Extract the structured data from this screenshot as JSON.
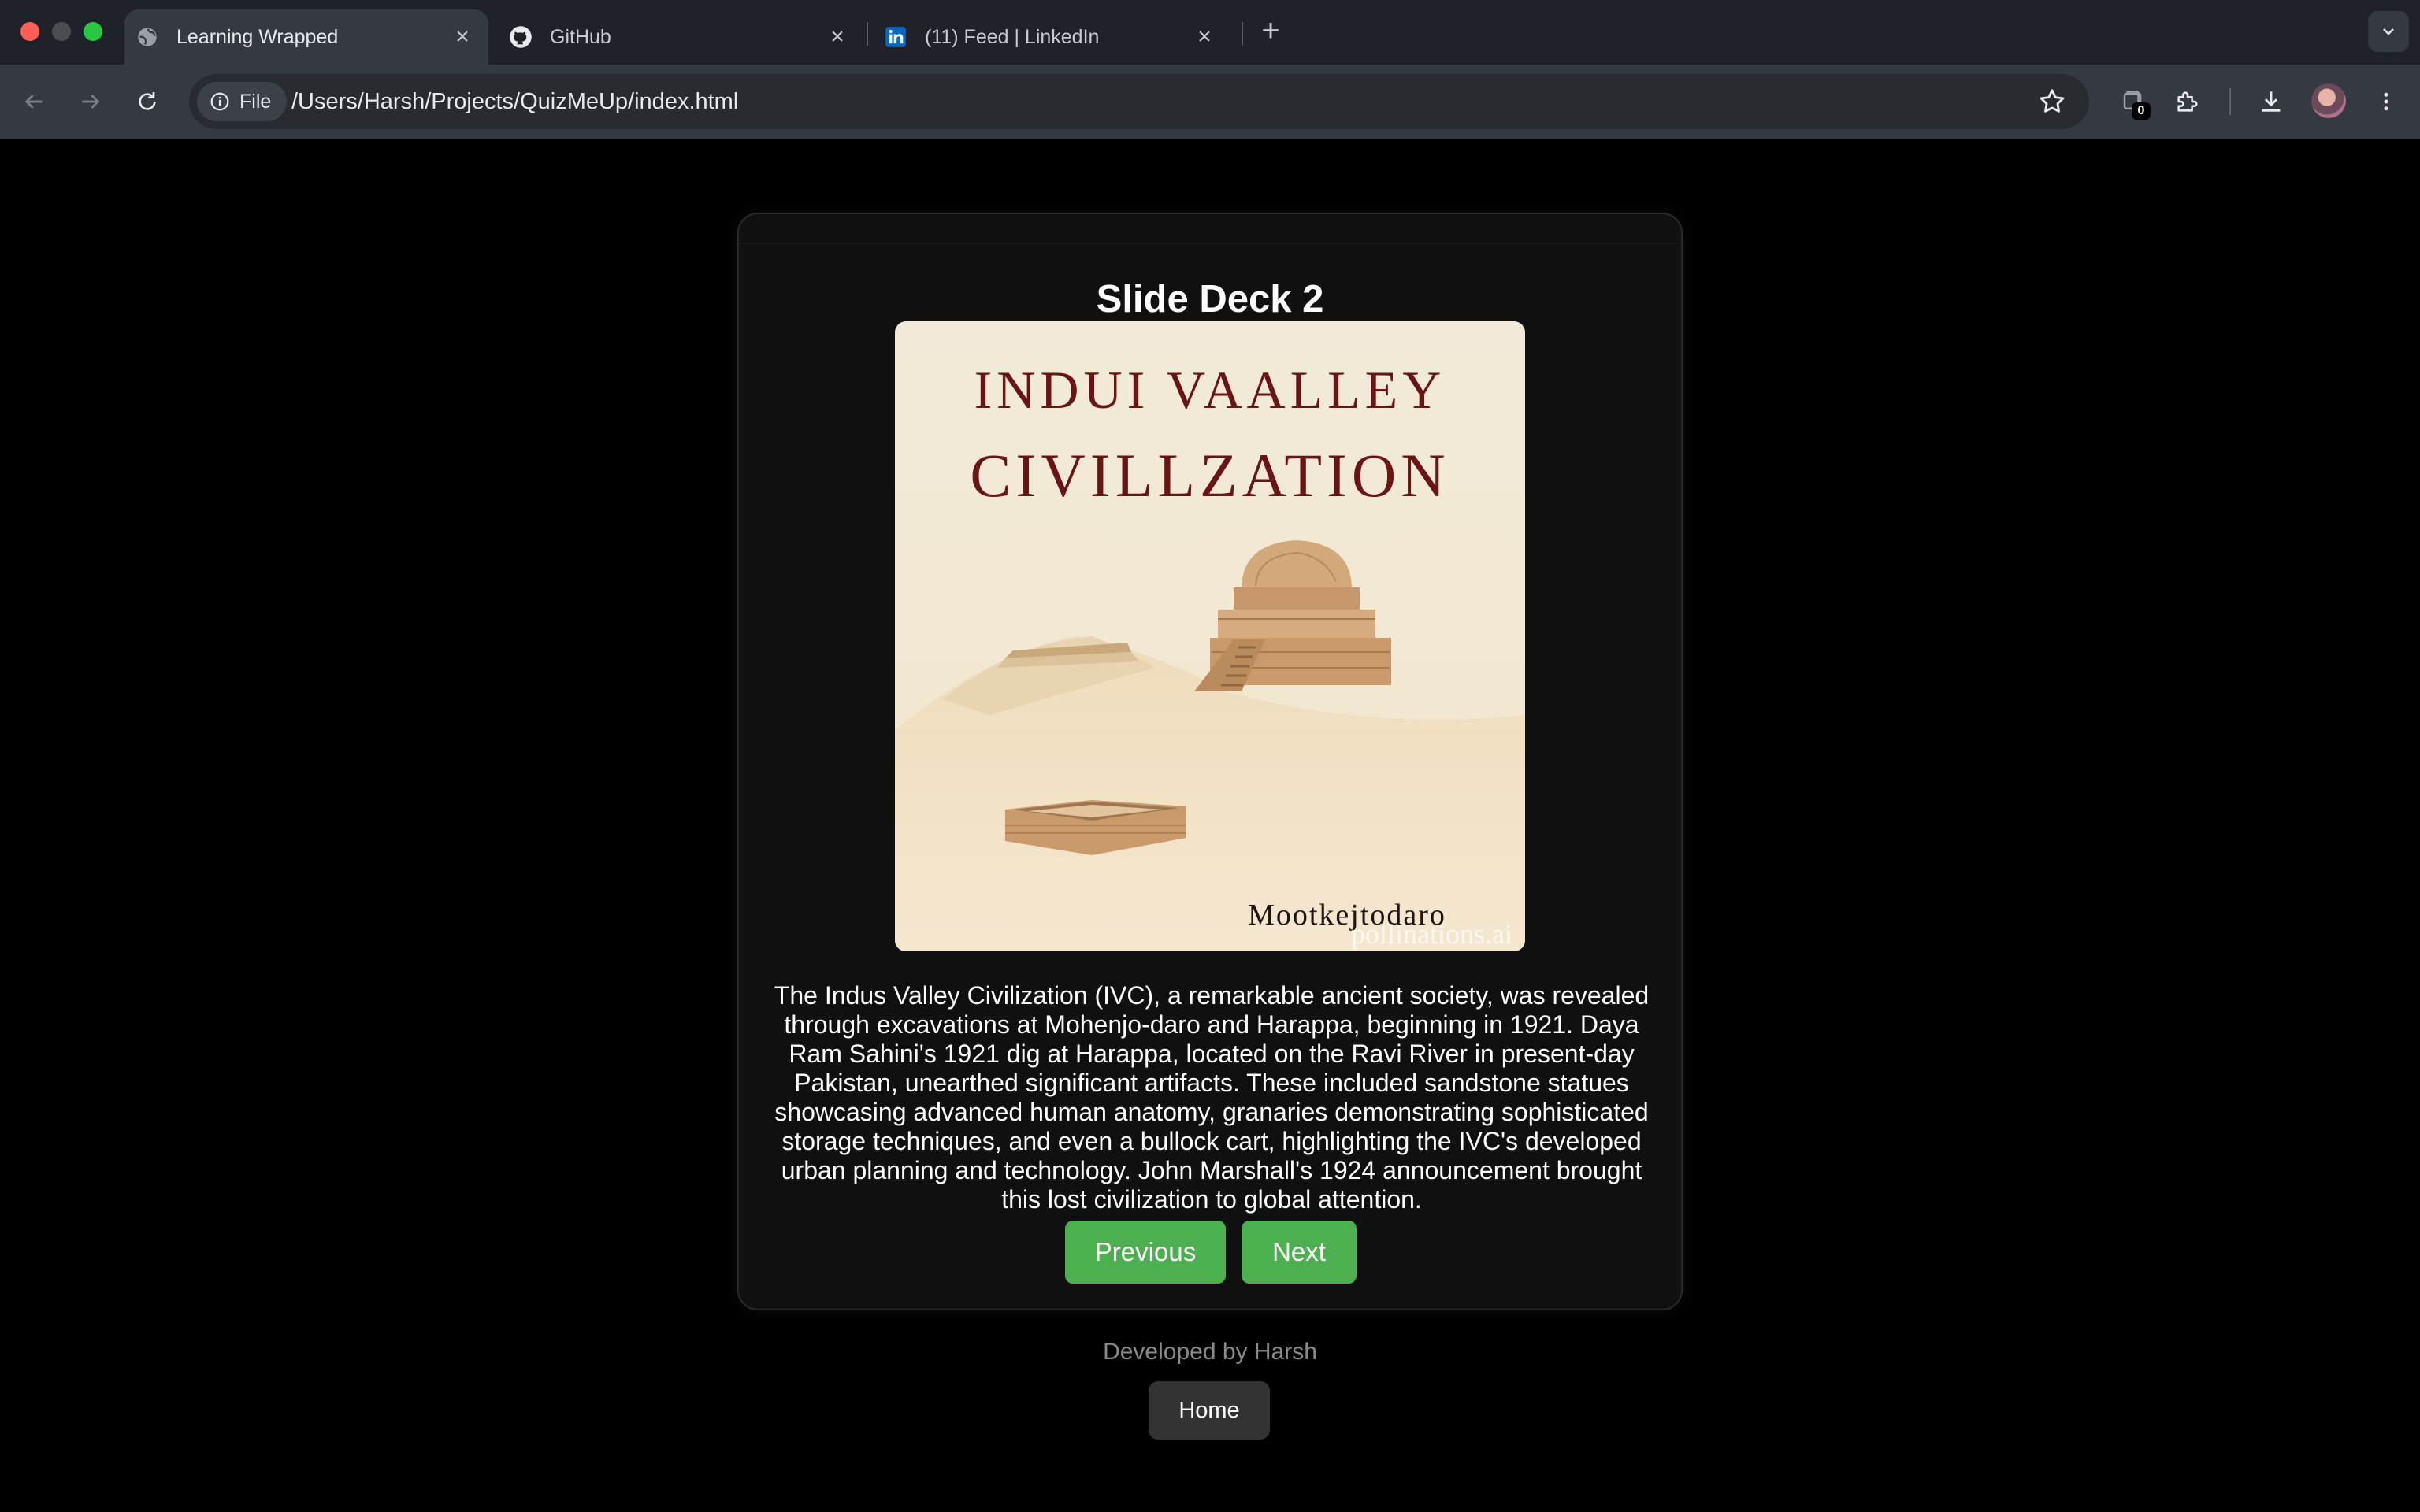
{
  "browser": {
    "tabs": [
      {
        "title": "Learning Wrapped",
        "icon": "globe-icon",
        "active": true
      },
      {
        "title": "GitHub",
        "icon": "github-icon",
        "active": false
      },
      {
        "title": "(11) Feed | LinkedIn",
        "icon": "linkedin-icon",
        "active": false
      }
    ],
    "address": {
      "chip_label": "File",
      "url": "/Users/Harsh/Projects/QuizMeUp/index.html"
    },
    "extension_badge": "0"
  },
  "slide": {
    "title": "Slide Deck 2",
    "image": {
      "heading_line1": "INDUI VAALLEY",
      "heading_line2": "CIVILLZATION",
      "caption": "Mootkejtodaro",
      "watermark": "pollinations.ai"
    },
    "body": "The Indus Valley Civilization (IVC), a remarkable ancient society, was revealed through excavations at Mohenjo-daro and Harappa, beginning in 1921. Daya Ram Sahini's 1921 dig at Harappa, located on the Ravi River in present-day Pakistan, unearthed significant artifacts. These included sandstone statues showcasing advanced human anatomy, granaries demonstrating sophisticated storage techniques, and even a bullock cart, highlighting the IVC's developed urban planning and technology. John Marshall's 1924 announcement brought this lost civilization to global attention.",
    "buttons": {
      "previous": "Previous",
      "next": "Next"
    }
  },
  "footer": {
    "credit": "Developed by Harsh",
    "home_button": "Home"
  },
  "colors": {
    "accent_button": "#4caf50",
    "page_background": "#000000",
    "card_background": "#101010"
  }
}
